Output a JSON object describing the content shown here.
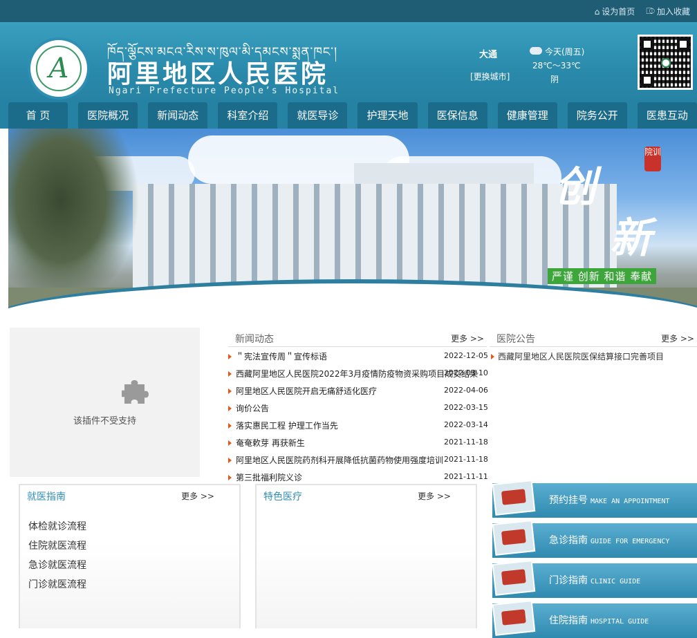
{
  "topbar": {
    "set_home": "设为首页",
    "add_fav": "加入收藏"
  },
  "header": {
    "tibetan": "ཁོད་ལྕོངས་མངའ་རིས་ས་ཁུལ་མི་དམངས་སྨན་ཁང་།",
    "cn_name": "阿里地区人民医院",
    "en_name": "Ngari Prefecture People’s Hospital"
  },
  "weather": {
    "city": "大通",
    "change": "[更换城市]",
    "day": "今天(周五)",
    "temp": "28℃～33℃",
    "cond": "阴"
  },
  "nav": [
    "首 页",
    "医院概况",
    "新闻动态",
    "科室介绍",
    "就医导诊",
    "护理天地",
    "医保信息",
    "健康管理",
    "院务公开",
    "医患互动"
  ],
  "banner": {
    "chuang": "创",
    "xin": "新",
    "seal": "院训",
    "motto": "严谨 创新 和谐 奉献"
  },
  "plugin": {
    "msg": "该插件不受支持"
  },
  "news": {
    "title": "新闻动态",
    "more": "更多 >>",
    "items": [
      {
        "t": "＂宪法宣传周＂宣传标语",
        "d": "2022-12-05"
      },
      {
        "t": "西藏阿里地区人民医院2022年3月疫情防疫物资采购项目成交结果",
        "d": "2022-03-10"
      },
      {
        "t": "阿里地区人民医院开启无痛舒适化医疗",
        "d": "2022-04-06"
      },
      {
        "t": "询价公告",
        "d": "2022-03-15"
      },
      {
        "t": "落实惠民工程 护理工作当先",
        "d": "2022-03-14"
      },
      {
        "t": "奄奄欶芽 再获新生",
        "d": "2021-11-18"
      },
      {
        "t": "阿里地区人民医院药剂科开展降低抗菌药物使用强度培训",
        "d": "2021-11-18"
      },
      {
        "t": "第三批福利院义诊",
        "d": "2021-11-11"
      }
    ]
  },
  "notice": {
    "title": "医院公告",
    "more": "更多 >>",
    "items": [
      {
        "t": "西藏阿里地区人民医院医保结算接口完善项目"
      }
    ]
  },
  "guide": {
    "title": "就医指南",
    "more": "更多 >>",
    "items": [
      "体检就诊流程",
      "住院就医流程",
      "急诊就医流程",
      "门诊就医流程"
    ]
  },
  "special": {
    "title": "特色医疗",
    "more": "更多 >>"
  },
  "services": [
    {
      "cn": "预约挂号",
      "en": "MAKE AN APPOINTMENT"
    },
    {
      "cn": "急诊指南",
      "en": "GUIDE FOR EMERGENCY"
    },
    {
      "cn": "门诊指南",
      "en": "CLINIC GUIDE"
    },
    {
      "cn": "住院指南",
      "en": "HOSPITAL GUIDE"
    }
  ]
}
